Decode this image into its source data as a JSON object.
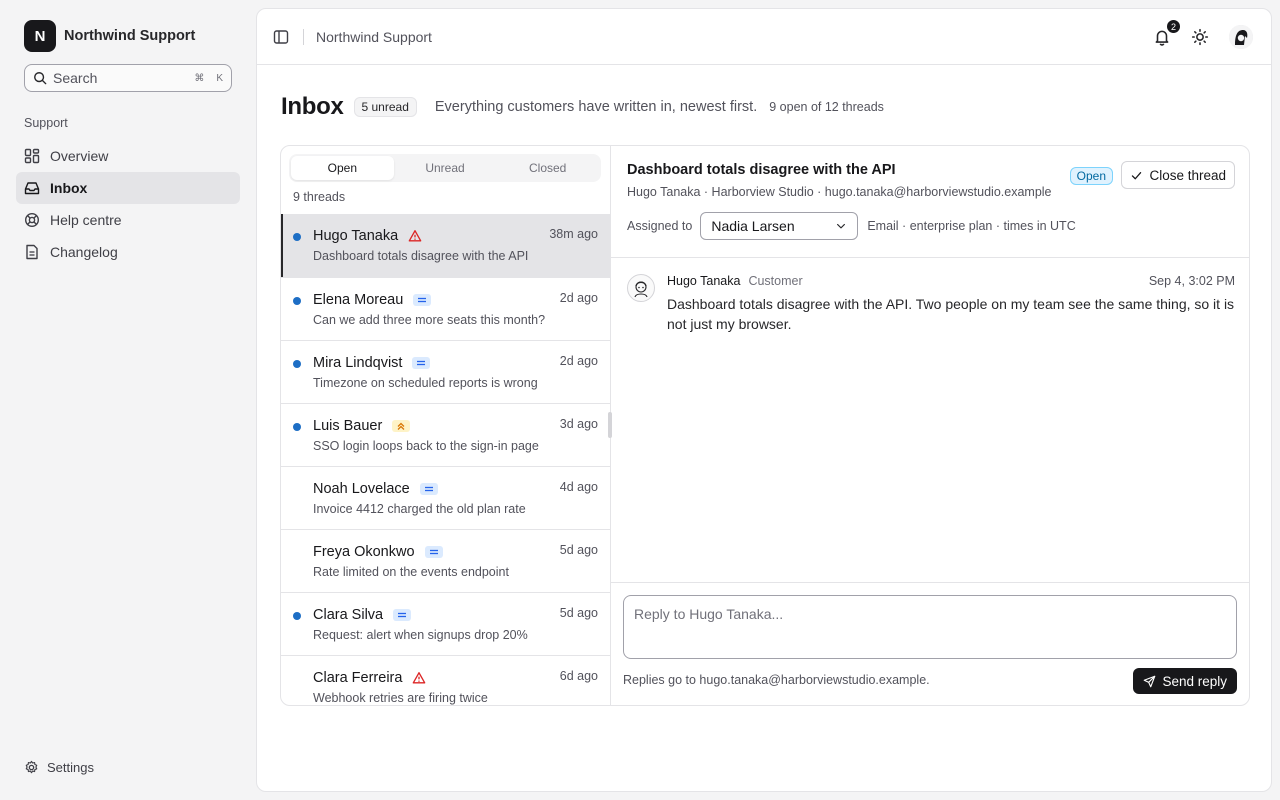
{
  "brand": {
    "initial": "N",
    "name": "Northwind Support"
  },
  "search": {
    "label": "Search",
    "shortcut_1": "⌘",
    "shortcut_2": "K"
  },
  "sidebar": {
    "section": "Support",
    "items": [
      {
        "label": "Overview",
        "icon": "grid-icon"
      },
      {
        "label": "Inbox",
        "icon": "inbox-icon",
        "active": true
      },
      {
        "label": "Help centre",
        "icon": "lifebuoy-icon"
      },
      {
        "label": "Changelog",
        "icon": "document-icon"
      }
    ],
    "settings": "Settings"
  },
  "topbar": {
    "title": "Northwind Support",
    "notifications": "2"
  },
  "page": {
    "title": "Inbox",
    "unread": "5 unread",
    "description": "Everything customers have written in, newest first.",
    "count": "9 open of 12 threads"
  },
  "tabs": [
    "Open",
    "Unread",
    "Closed"
  ],
  "thread_count": "9 threads",
  "threads": [
    {
      "name": "Hugo Tanaka",
      "subject": "Dashboard totals disagree with the API",
      "time": "38m ago",
      "unread": true,
      "priority": "urgent"
    },
    {
      "name": "Elena Moreau",
      "subject": "Can we add three more seats this month?",
      "time": "2d ago",
      "unread": true,
      "priority": "normal"
    },
    {
      "name": "Mira Lindqvist",
      "subject": "Timezone on scheduled reports is wrong",
      "time": "2d ago",
      "unread": true,
      "priority": "normal"
    },
    {
      "name": "Luis Bauer",
      "subject": "SSO login loops back to the sign-in page",
      "time": "3d ago",
      "unread": true,
      "priority": "high"
    },
    {
      "name": "Noah Lovelace",
      "subject": "Invoice 4412 charged the old plan rate",
      "time": "4d ago",
      "unread": false,
      "priority": "normal"
    },
    {
      "name": "Freya Okonkwo",
      "subject": "Rate limited on the events endpoint",
      "time": "5d ago",
      "unread": false,
      "priority": "normal"
    },
    {
      "name": "Clara Silva",
      "subject": "Request: alert when signups drop 20%",
      "time": "5d ago",
      "unread": true,
      "priority": "normal"
    },
    {
      "name": "Clara Ferreira",
      "subject": "Webhook retries are firing twice",
      "time": "6d ago",
      "unread": false,
      "priority": "urgent"
    }
  ],
  "detail": {
    "title": "Dashboard totals disagree with the API",
    "meta": "Hugo Tanaka · Harborview Studio · hugo.tanaka@harborviewstudio.example",
    "status": "Open",
    "close_label": "Close thread",
    "assigned_label": "Assigned to",
    "assignee": "Nadia Larsen",
    "info": "Email · enterprise plan · times in UTC"
  },
  "message": {
    "author": "Hugo Tanaka",
    "role": "Customer",
    "time": "Sep 4, 3:02 PM",
    "body": "Dashboard totals disagree with the API. Two people on my team see the same thing, so it is not just my browser."
  },
  "composer": {
    "placeholder": "Reply to Hugo Tanaka...",
    "note": "Replies go to hugo.tanaka@harborviewstudio.example.",
    "send_label": "Send reply"
  },
  "colors": {
    "unread_dot": "#1d6ec5",
    "status_open": "#0369a1",
    "urgent": "#dc2626",
    "high": "#d97706",
    "primary": "#18181b"
  }
}
